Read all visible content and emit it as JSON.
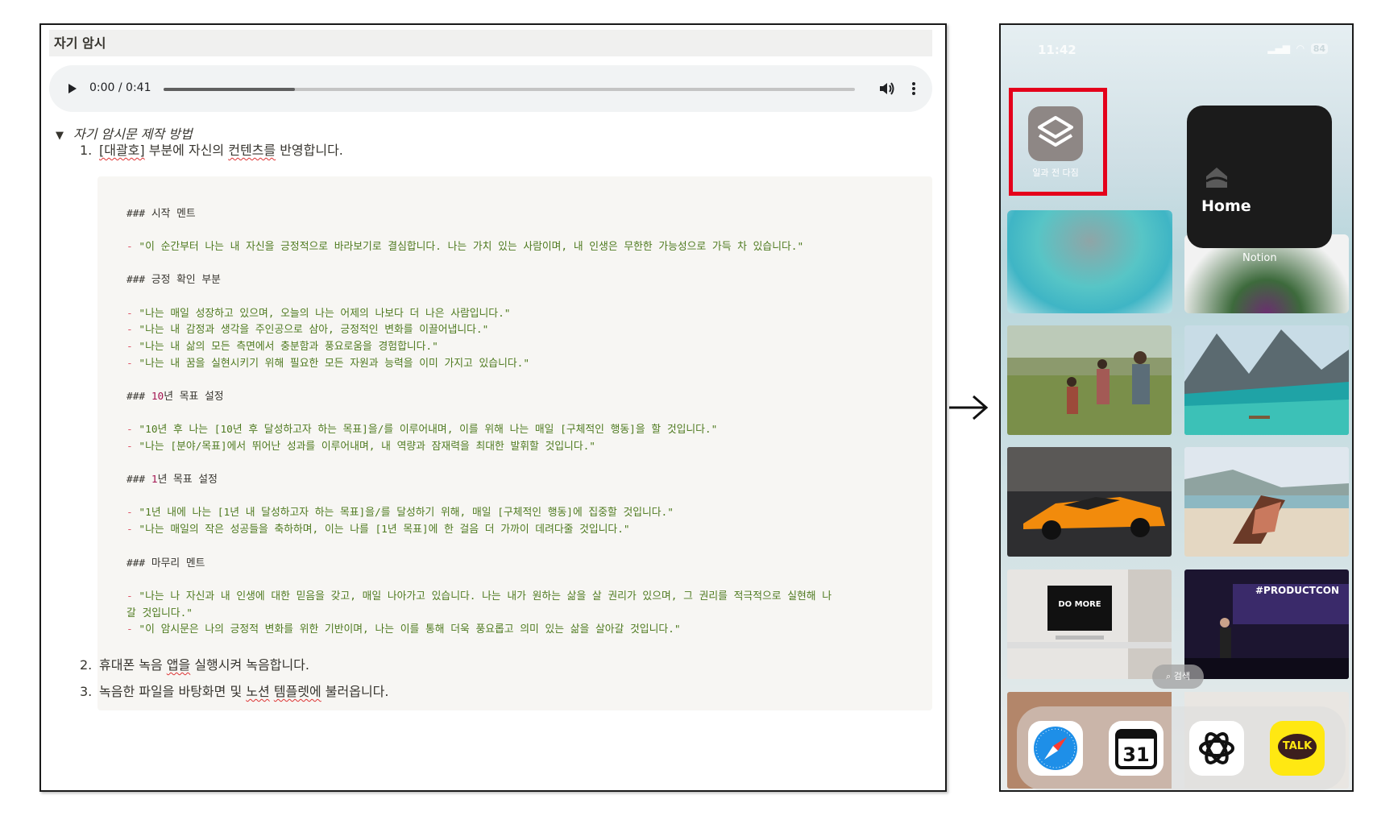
{
  "notion": {
    "title": "자기 암시",
    "audio": {
      "current_time": "0:00",
      "duration": "0:41",
      "time_display": "0:00 / 0:41",
      "progress_fraction": 0.19
    },
    "toggle_label": "자기 암시문 제작 방법",
    "steps": [
      {
        "num": "1.",
        "pre": "",
        "mark1": "[대괄호]",
        "mid": " 부분에 자신의 ",
        "mark2": "컨텐츠를",
        "post": " 반영합니다."
      },
      {
        "num": "2.",
        "pre": "휴대폰 녹음 ",
        "mark1": "앱을",
        "post": " 실행시켜 녹음합니다."
      },
      {
        "num": "3.",
        "pre": "녹음한 파일을 바탕화면 및 ",
        "mark1": "노션",
        "mid": " ",
        "mark2": "템플렛에",
        "post": " 불러옵니다."
      }
    ],
    "code_lines": [
      {
        "kind": "header",
        "hash": "###",
        "text": " 시작 멘트"
      },
      {
        "kind": "bullet",
        "text": "\"이 순간부터 나는 내 자신을 긍정적으로 바라보기로 결심합니다. 나는 가치 있는 사람이며, 내 인생은 무한한 가능성으로 가득 차 있습니다.\""
      },
      {
        "kind": "header",
        "hash": "###",
        "text": " 긍정 확인 부분"
      },
      {
        "kind": "bullet",
        "text": "\"나는 매일 성장하고 있으며, 오늘의 나는 어제의 나보다 더 나은 사람입니다.\""
      },
      {
        "kind": "bullet",
        "text": "\"나는 내 감정과 생각을 주인공으로 삼아, 긍정적인 변화를 이끌어냅니다.\""
      },
      {
        "kind": "bullet",
        "text": "\"나는 내 삶의 모든 측면에서 충분함과 풍요로움을 경험합니다.\""
      },
      {
        "kind": "bullet",
        "text": "\"나는 내 꿈을 실현시키기 위해 필요한 모든 자원과 능력을 이미 가지고 있습니다.\""
      },
      {
        "kind": "header",
        "hash": "###",
        "num": "10",
        "text": "년 목표 설정"
      },
      {
        "kind": "bullet",
        "text": "\"10년 후 나는 [10년 후 달성하고자 하는 목표]을/를 이루어내며, 이를 위해 나는 매일 [구체적인 행동]을 할 것입니다.\""
      },
      {
        "kind": "bullet",
        "text": "\"나는 [분야/목표]에서 뛰어난 성과를 이루어내며, 내 역량과 잠재력을 최대한 발휘할 것입니다.\""
      },
      {
        "kind": "header",
        "hash": "###",
        "num": "1",
        "text": "년 목표 설정"
      },
      {
        "kind": "bullet",
        "text": "\"1년 내에 나는 [1년 내 달성하고자 하는 목표]을/를 달성하기 위해, 매일 [구체적인 행동]에 집중할 것입니다.\""
      },
      {
        "kind": "bullet",
        "text": "\"나는 매일의 작은 성공들을 축하하며, 이는 나를 [1년 목표]에 한 걸음 더 가까이 데려다줄 것입니다.\""
      },
      {
        "kind": "header",
        "hash": "###",
        "text": " 마무리 멘트"
      },
      {
        "kind": "bullet",
        "text": "\"나는 나 자신과 내 인생에 대한 믿음을 갖고, 매일 나아가고 있습니다. 나는 내가 원하는 삶을 살 권리가 있으며, 그 권리를 적극적으로 실현해 나"
      },
      {
        "kind": "cont",
        "text": "갈 것입니다.\""
      },
      {
        "kind": "bullet",
        "text": "\"이 암시문은 나의 긍정적 변화를 위한 기반이며, 나는 이를 통해 더욱 풍요롭고 의미 있는 삶을 살아갈 것입니다.\""
      }
    ],
    "dash": "- "
  },
  "phone": {
    "status_time": "11:42",
    "battery": "84",
    "shortcut_label": "일과 전 다짐",
    "home_widget_label": "Home",
    "notion_label": "Notion",
    "search_label": "검색",
    "photo_banner_text": "#PRODUCTCON",
    "desk_text": "DO MORE",
    "calendar_day": "31",
    "kakao_label": "TALK"
  },
  "colors": {
    "highlight": "#e4001b",
    "code_string": "#4e7a1f",
    "code_dash": "#e0566b",
    "code_number": "#a31551",
    "kakao_yellow": "#ffe812"
  },
  "icons": [
    "play-icon",
    "volume-icon",
    "more-vertical-icon",
    "toggle-triangle-icon",
    "arrow-right-icon",
    "shortcuts-icon",
    "home-icon",
    "search-icon",
    "safari-icon",
    "calendar-icon",
    "chatgpt-icon",
    "kakaotalk-icon"
  ]
}
